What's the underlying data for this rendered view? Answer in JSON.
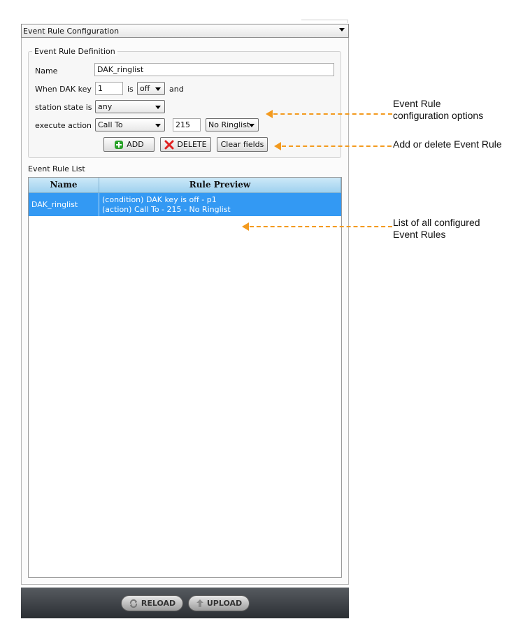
{
  "panel": {
    "title": "Event Rule Configuration"
  },
  "definition": {
    "legend": "Event Rule Definition",
    "name_label": "Name",
    "name_value": "DAK_ringlist",
    "dak_label": "When DAK key",
    "dak_value": "1",
    "is_label": "is",
    "state_value": "off",
    "and_label": "and",
    "station_label": "station state is",
    "station_value": "any",
    "action_label": "execute action",
    "action_value": "Call To",
    "number_value": "215",
    "ringlist_value": "No Ringlist",
    "add_label": "ADD",
    "delete_label": "DELETE",
    "clear_label": "Clear fields"
  },
  "list": {
    "label": "Event Rule List",
    "headers": [
      "Name",
      "Rule Preview"
    ],
    "rows": [
      {
        "name": "DAK_ringlist",
        "preview_line1": "(condition) DAK key is off - p1",
        "preview_line2": "(action) Call To - 215 - No Ringlist"
      }
    ]
  },
  "footer": {
    "reload_label": "RELOAD",
    "upload_label": "UPLOAD"
  },
  "annotations": {
    "config_line1": "Event Rule",
    "config_line2": "configuration options",
    "add_delete": "Add or delete Event Rule",
    "list_line1": "List of all configured",
    "list_line2": "Event Rules",
    "color": "#f39a1e"
  },
  "colors": {
    "selection": "#3399f3",
    "header": "#9fd1ef",
    "add_icon": "#2aa12a",
    "delete_icon": "#e02020"
  }
}
